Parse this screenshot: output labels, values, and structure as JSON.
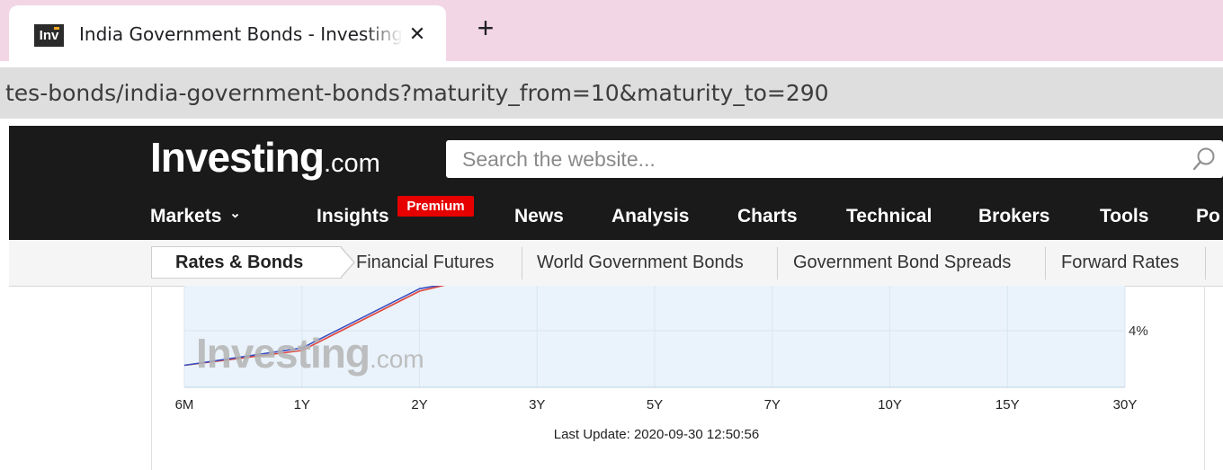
{
  "browser": {
    "tab_title": "India Government Bonds - Investing.com",
    "favicon_text": "Inv",
    "close_symbol": "✕",
    "new_tab_symbol": "+",
    "url": "tes-bonds/india-government-bonds?maturity_from=10&maturity_to=290"
  },
  "site": {
    "logo_main": "Investing",
    "logo_suffix": ".com",
    "search_placeholder": "Search the website...",
    "nav": {
      "markets": "Markets",
      "markets_caret": "⌄",
      "insights": "Insights",
      "premium_badge": "Premium",
      "news": "News",
      "analysis": "Analysis",
      "charts": "Charts",
      "technical": "Technical",
      "brokers": "Brokers",
      "tools": "Tools",
      "portfolio_partial": "Po"
    },
    "subnav": {
      "rates_bonds": "Rates & Bonds",
      "financial_futures": "Financial Futures",
      "world_government_bonds": "World Government Bonds",
      "government_bond_spreads": "Government Bond Spreads",
      "forward_rates": "Forward Rates"
    }
  },
  "chart_data": {
    "type": "line",
    "categories": [
      "6M",
      "1Y",
      "2Y",
      "3Y",
      "5Y",
      "7Y",
      "10Y",
      "15Y",
      "30Y"
    ],
    "y_tick_labels": [
      "4%"
    ],
    "series": [
      {
        "values": [
          3.3,
          3.6,
          4.8,
          null,
          null,
          null,
          null,
          null,
          null
        ]
      },
      {
        "values": [
          3.3,
          3.65,
          4.85,
          null,
          null,
          null,
          null,
          null,
          null
        ]
      }
    ],
    "colors": {
      "series_a": "#e0443c",
      "series_b": "#3a4fc0",
      "fill": "#eaf3fb"
    },
    "watermark_main": "Investing",
    "watermark_suffix": ".com",
    "last_update": "Last Update: 2020-09-30 12:50:56",
    "grid": true
  },
  "colors": {
    "header_bg": "#1a1a1a",
    "premium_red": "#e60000",
    "tabstrip_pink": "#f3d6e5"
  }
}
